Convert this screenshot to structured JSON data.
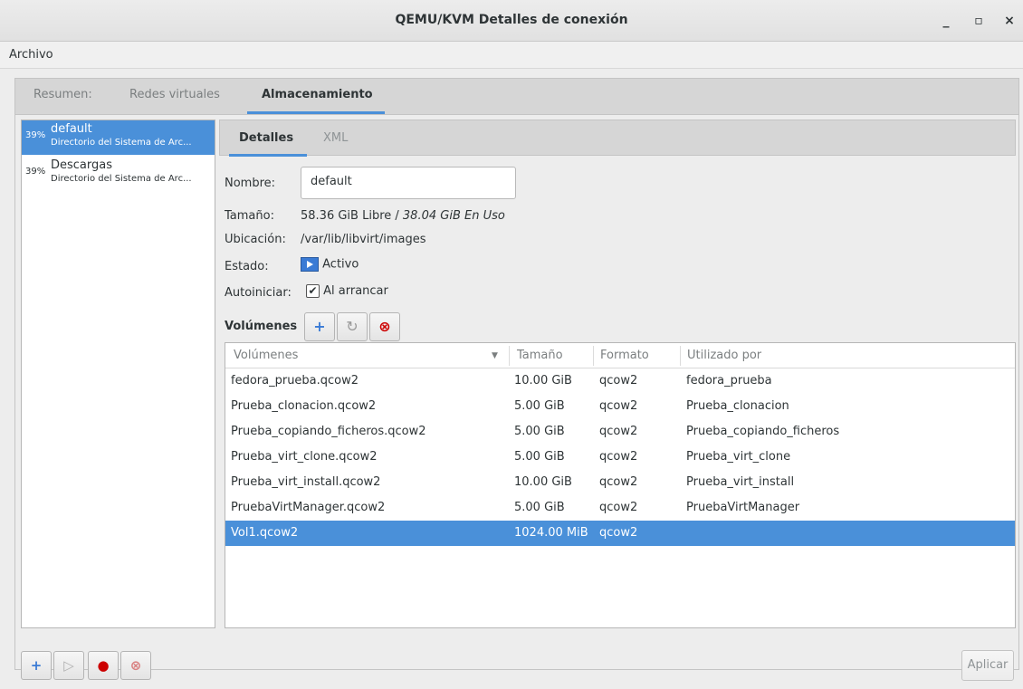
{
  "window": {
    "title": "QEMU/KVM Detalles de conexión",
    "minimize": "_",
    "maximize": "▫",
    "close": "×"
  },
  "menubar": {
    "file": "Archivo"
  },
  "tabs": [
    "Resumen:",
    "Redes virtuales",
    "Almacenamiento"
  ],
  "pools": [
    {
      "pct": "39%",
      "name": "default",
      "desc": "Directorio del Sistema de Arc..."
    },
    {
      "pct": "39%",
      "name": "Descargas",
      "desc": "Directorio del Sistema de Arc..."
    }
  ],
  "inner_tabs": [
    "Detalles",
    "XML"
  ],
  "details": {
    "name_label": "Nombre:",
    "name_value": "default",
    "size_label": "Tamaño:",
    "size_free": "58.36 GiB Libre / ",
    "size_used": "38.04 GiB En Uso",
    "location_label": "Ubicación:",
    "location_value": "/var/lib/libvirt/images",
    "state_label": "Estado:",
    "state_value": "Activo",
    "autostart_label": "Autoiniciar:",
    "autostart_value": "Al arrancar",
    "volumes_label": "Volúmenes"
  },
  "volume_toolbar": {
    "add": "+",
    "refresh": "↻",
    "delete": "⊗"
  },
  "columns": [
    "Volúmenes",
    "Tamaño",
    "Formato",
    "Utilizado por"
  ],
  "sort_indicator": "▼",
  "volumes": [
    {
      "name": "fedora_prueba.qcow2",
      "size": "10.00 GiB",
      "format": "qcow2",
      "used_by": "fedora_prueba"
    },
    {
      "name": "Prueba_clonacion.qcow2",
      "size": "5.00 GiB",
      "format": "qcow2",
      "used_by": "Prueba_clonacion"
    },
    {
      "name": "Prueba_copiando_ficheros.qcow2",
      "size": "5.00 GiB",
      "format": "qcow2",
      "used_by": "Prueba_copiando_ficheros"
    },
    {
      "name": "Prueba_virt_clone.qcow2",
      "size": "5.00 GiB",
      "format": "qcow2",
      "used_by": "Prueba_virt_clone"
    },
    {
      "name": "Prueba_virt_install.qcow2",
      "size": "10.00 GiB",
      "format": "qcow2",
      "used_by": "Prueba_virt_install"
    },
    {
      "name": "PruebaVirtManager.qcow2",
      "size": "5.00 GiB",
      "format": "qcow2",
      "used_by": "PruebaVirtManager"
    },
    {
      "name": "Vol1.qcow2",
      "size": "1024.00 MiB",
      "format": "qcow2",
      "used_by": ""
    }
  ],
  "bottom_toolbar": {
    "add": "+",
    "start": "▷",
    "stop": "●",
    "delete": "⊗"
  },
  "apply_label": "Aplicar",
  "colors": {
    "accent": "#4a90d9",
    "stop": "#cc0000",
    "delete": "#cc0000"
  }
}
